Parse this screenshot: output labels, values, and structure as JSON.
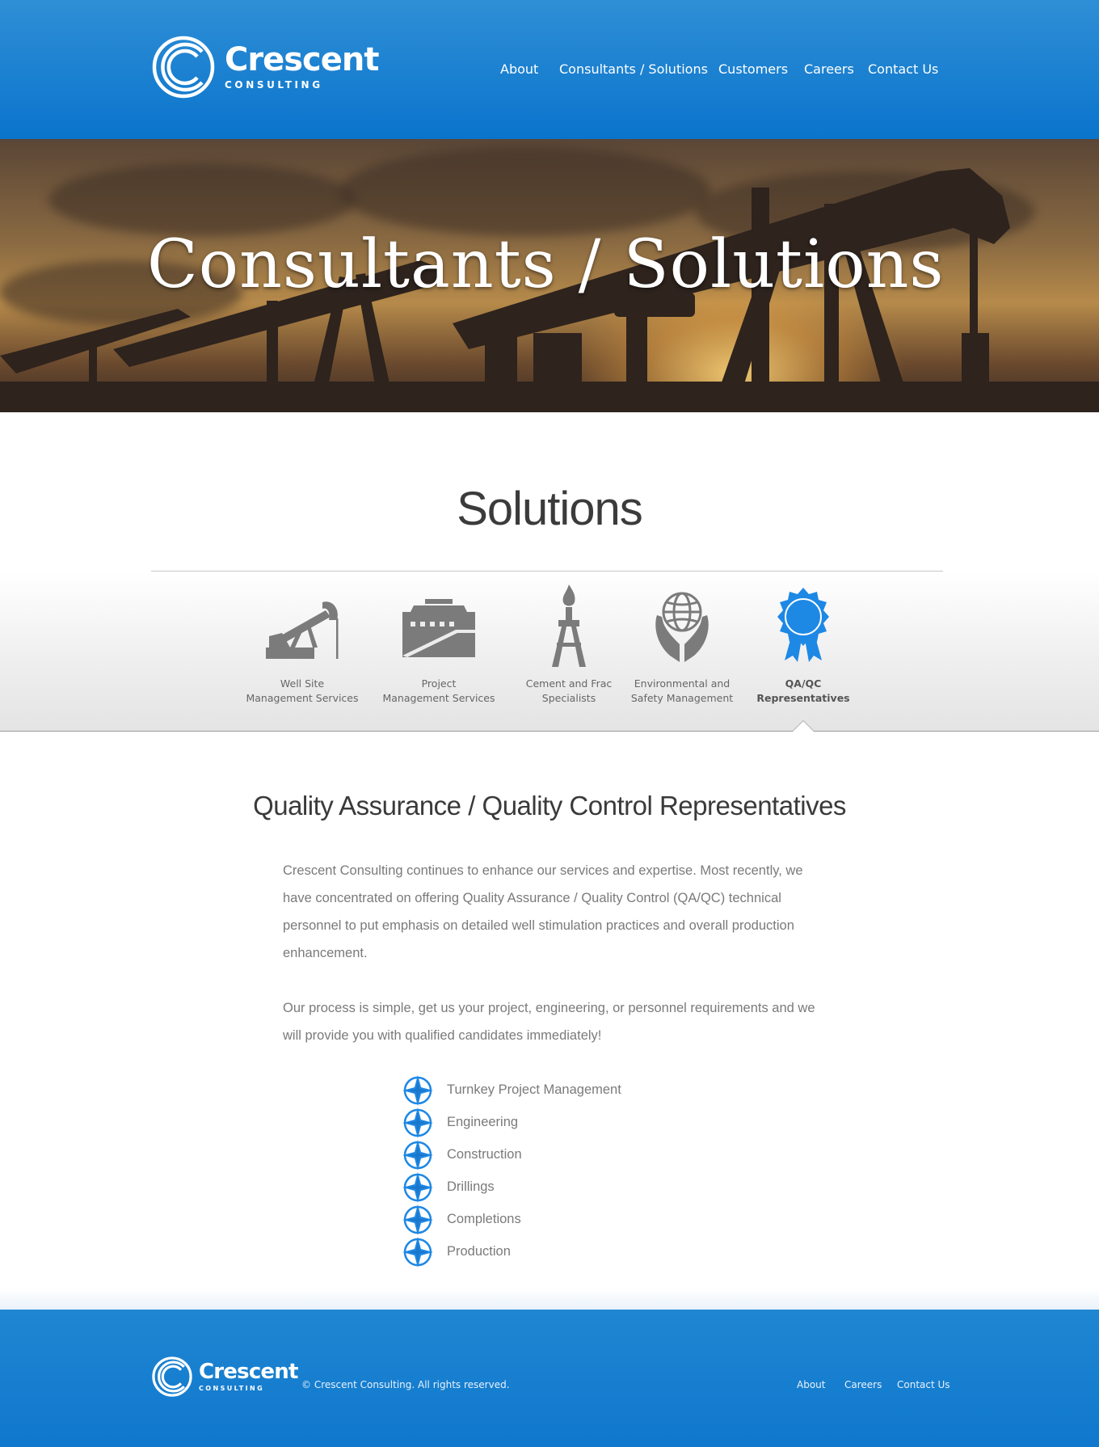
{
  "brand": {
    "name": "Crescent",
    "tagline": "CONSULTING"
  },
  "nav": [
    {
      "label": "About"
    },
    {
      "label": "Consultants / Solutions"
    },
    {
      "label": "Customers"
    },
    {
      "label": "Careers"
    },
    {
      "label": "Contact Us"
    }
  ],
  "hero": {
    "title": "Consultants / Solutions"
  },
  "solutions": {
    "title": "Solutions",
    "tabs": [
      {
        "label_line1": "Well Site",
        "label_line2": "Management Services",
        "icon": "pumpjack-icon",
        "active": false
      },
      {
        "label_line1": "Project",
        "label_line2": "Management Services",
        "icon": "map-board-icon",
        "active": false
      },
      {
        "label_line1": "Cement and Frac",
        "label_line2": "Specialists",
        "icon": "flare-tower-icon",
        "active": false
      },
      {
        "label_line1": "Environmental and",
        "label_line2": "Safety Management",
        "icon": "hands-globe-icon",
        "active": false
      },
      {
        "label_line1": "QA/QC",
        "label_line2": "Representatives",
        "icon": "award-ribbon-icon",
        "active": true
      }
    ]
  },
  "content": {
    "heading": "Quality Assurance / Quality Control Representatives",
    "paragraph1": "Crescent Consulting continues to enhance our services and expertise.  Most recently, we have concentrated on offering Quality Assurance / Quality Control (QA/QC) technical personnel to put emphasis on detailed well stimulation practices and overall production enhancement.",
    "paragraph2": "Our process is simple, get us your project, engineering, or personnel requirements and we will provide you with qualified candidates immediately!",
    "list": [
      "Turnkey Project Management",
      "Engineering",
      "Construction",
      "Drillings",
      "Completions",
      "Production"
    ],
    "list_icon": "compass-star-icon"
  },
  "footer": {
    "copyright": "© Crescent Consulting. All rights reserved.",
    "links": [
      "About",
      "Careers",
      "Contact Us"
    ]
  },
  "colors": {
    "brand_blue": "#0a74cc",
    "accent_blue": "#1e88e5",
    "icon_gray": "#7b7b7b",
    "heading_dark": "#3b3b3b",
    "body_text": "#7a7a7a"
  }
}
